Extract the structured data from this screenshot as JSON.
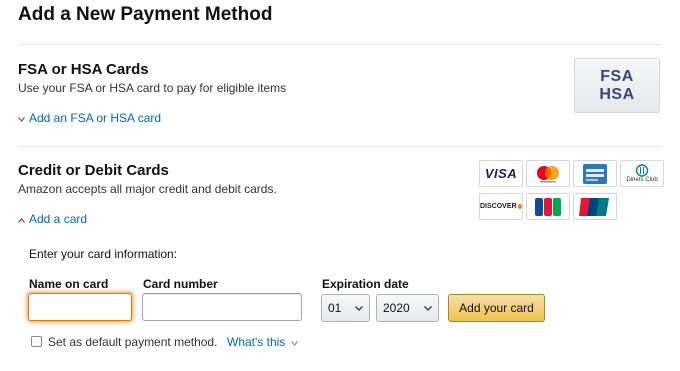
{
  "page": {
    "title": "Add a New Payment Method"
  },
  "fsa": {
    "heading": "FSA or HSA Cards",
    "description": "Use your FSA or HSA card to pay for eligible items",
    "add_link": "Add an FSA or HSA card",
    "logo_line1": "FSA",
    "logo_line2": "HSA"
  },
  "credit": {
    "heading": "Credit or Debit Cards",
    "description": "Amazon accepts all major credit and debit cards.",
    "add_link": "Add a card",
    "card_logos": [
      "visa-logo",
      "mastercard-logo",
      "amex-logo",
      "diners-club-logo",
      "discover-logo",
      "jcb-logo",
      "unionpay-logo"
    ],
    "visa_text": "VISA",
    "discover_text": "DISCOVER",
    "jcb_text": "JCB",
    "diners_text": "Diners Club"
  },
  "form": {
    "intro": "Enter your card information:",
    "name_label": "Name on card",
    "name_value": "",
    "number_label": "Card number",
    "number_value": "",
    "expiration_label": "Expiration date",
    "month": "01",
    "year": "2020",
    "submit": "Add your card",
    "default_label": "Set as default payment method.",
    "default_checked": false,
    "whats_this": "What's this"
  },
  "colors": {
    "link": "#0066c0",
    "button_top": "#f7dfa5",
    "button_bottom": "#f0c14b",
    "focus": "#e77600"
  }
}
